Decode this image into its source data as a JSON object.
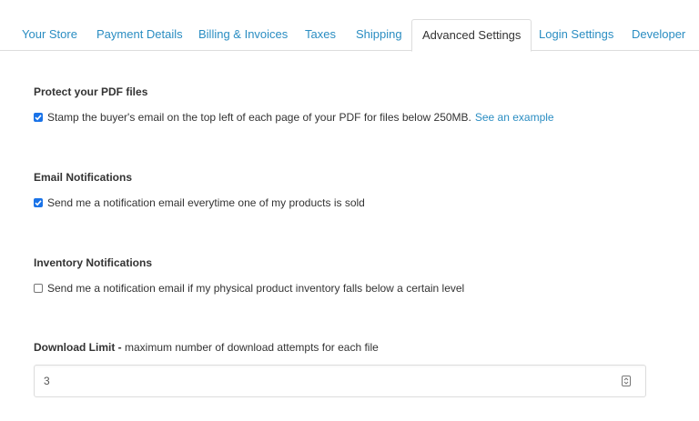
{
  "tabs": [
    {
      "label": "Your Store"
    },
    {
      "label": "Payment Details"
    },
    {
      "label": "Billing & Invoices"
    },
    {
      "label": "Taxes"
    },
    {
      "label": "Shipping"
    },
    {
      "label": "Advanced Settings",
      "active": true
    },
    {
      "label": "Login Settings"
    },
    {
      "label": "Developer"
    }
  ],
  "pdf": {
    "title": "Protect your PDF files",
    "checkbox_label": "Stamp the buyer's email on the top left of each page of your PDF for files below 250MB.",
    "checked": true,
    "link": "See an example"
  },
  "email": {
    "title": "Email Notifications",
    "checkbox_label": "Send me a notification email everytime one of my products is sold",
    "checked": true
  },
  "inventory": {
    "title": "Inventory Notifications",
    "checkbox_label": "Send me a notification email if my physical product inventory falls below a certain level",
    "checked": false
  },
  "download_limit": {
    "label_bold": "Download Limit -",
    "label_rest": "maximum number of download attempts for each file",
    "value": "3"
  },
  "colors": {
    "link": "#2a8dc2",
    "checkbox": "#1a73e8"
  }
}
